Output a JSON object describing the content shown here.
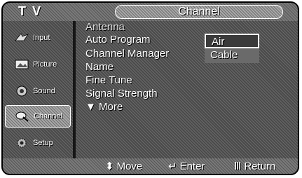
{
  "header": {
    "app_label": "T V",
    "title": "Channel"
  },
  "sidebar": {
    "items": [
      {
        "label": "Input",
        "icon": "input-icon"
      },
      {
        "label": "Picture",
        "icon": "picture-icon"
      },
      {
        "label": "Sound",
        "icon": "sound-icon"
      },
      {
        "label": "Channel",
        "icon": "channel-icon"
      },
      {
        "label": "Setup",
        "icon": "setup-icon"
      }
    ],
    "active": "Channel"
  },
  "menu": {
    "items": [
      "Antenna",
      "Auto Program",
      "Channel Manager",
      "Name",
      "Fine Tune",
      "Signal Strength"
    ],
    "more_label": "More",
    "active": "Antenna"
  },
  "submenu": {
    "options": [
      "Air",
      "Cable"
    ],
    "selected": "Air"
  },
  "footer": {
    "move_label": "Move",
    "move_glyph": "⬍",
    "enter_label": "Enter",
    "enter_glyph": "↵",
    "return_label": "Return",
    "return_glyph": "Ⅲ"
  }
}
